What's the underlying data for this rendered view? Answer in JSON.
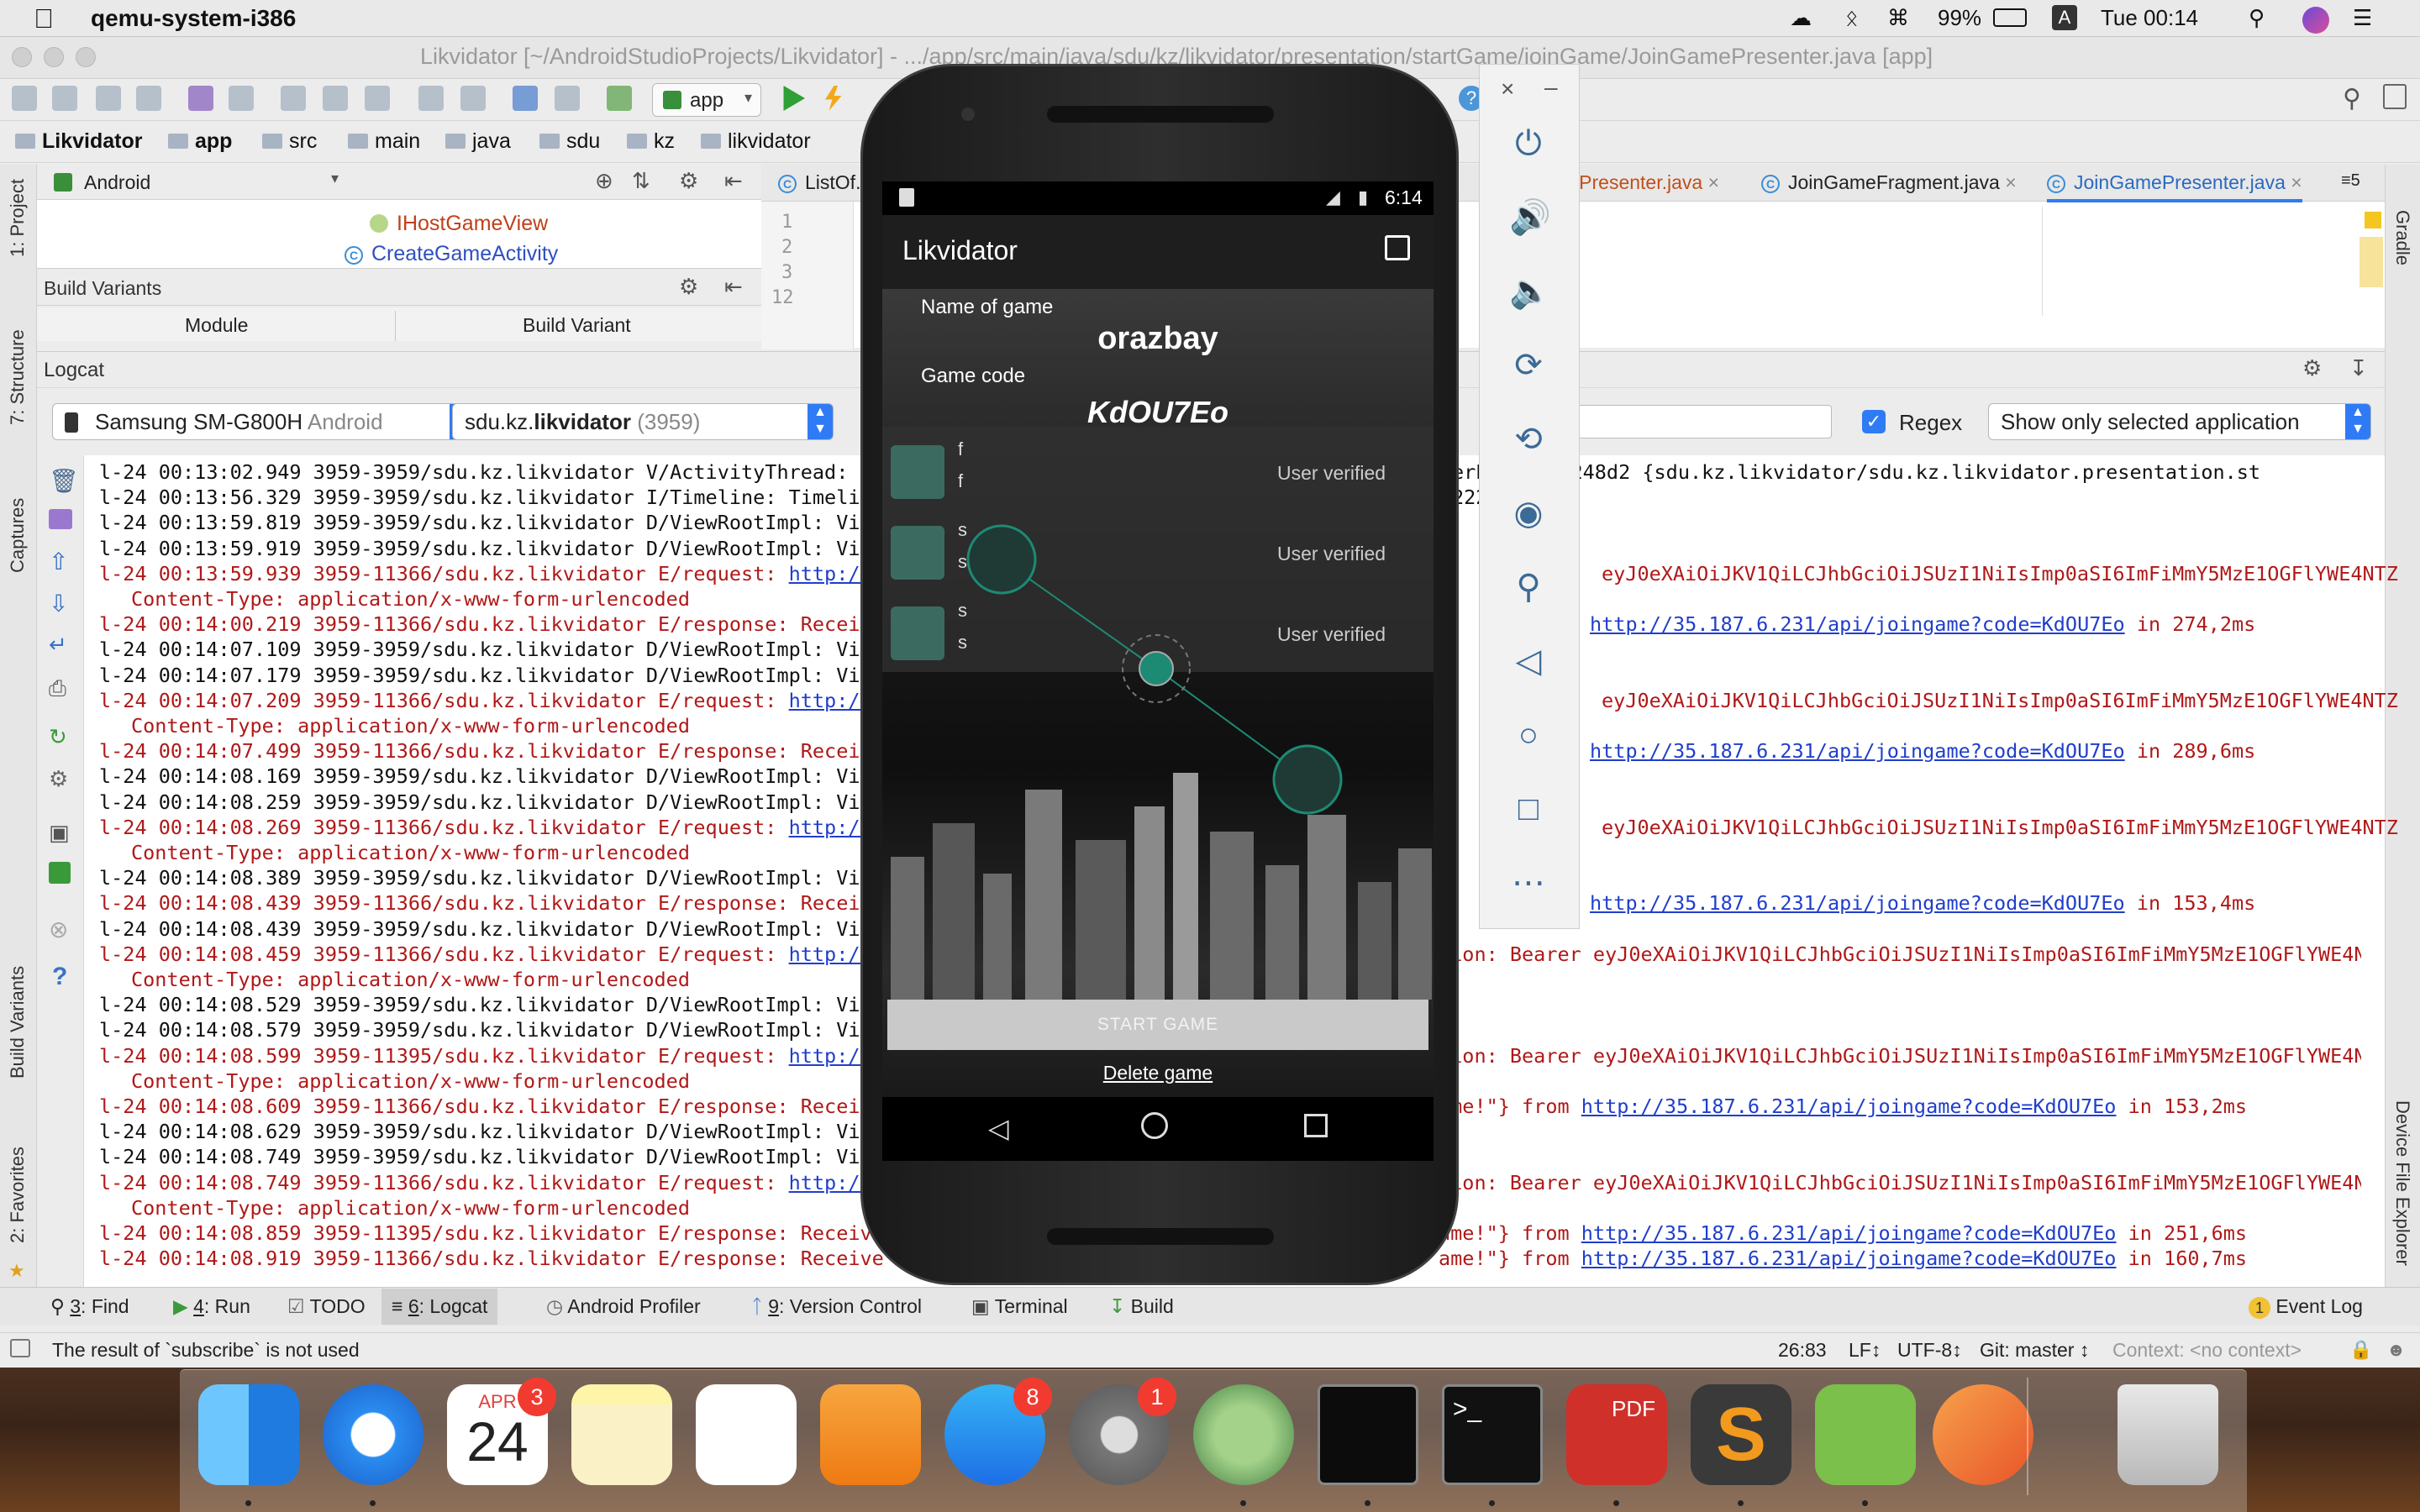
{
  "menubar": {
    "app_name": "qemu-system-i386",
    "battery": "99%",
    "input_source": "A",
    "clock": "Tue 00:14"
  },
  "window": {
    "title": "Likvidator [~/AndroidStudioProjects/Likvidator] - .../app/src/main/java/sdu/kz/likvidator/presentation/startGame/joinGame/JoinGamePresenter.java [app]"
  },
  "toolbar": {
    "run_config": "app"
  },
  "breadcrumb": [
    "Likvidator",
    "app",
    "src",
    "main",
    "java",
    "sdu",
    "kz",
    "likvidator"
  ],
  "project_panel": {
    "view_mode": "Android",
    "items": [
      "IHostGameView",
      "CreateGameActivity"
    ]
  },
  "build_variants": {
    "title": "Build Variants",
    "columns": [
      "Module",
      "Build Variant"
    ]
  },
  "editor": {
    "tabs": [
      "ListOf...",
      "...Presenter.java",
      "JoinGameFragment.java",
      "JoinGamePresenter.java"
    ],
    "tab_overflow": "5",
    "line_numbers": [
      "1",
      "2",
      "3",
      "12"
    ]
  },
  "logcat": {
    "title": "Logcat",
    "device": "Samsung SM-G800H",
    "device_os": "Android",
    "process_prefix": "sdu.kz.",
    "process_bold": "likvidator",
    "process_pid": "(3959)",
    "regex_label": "Regex",
    "regex_checked": true,
    "filter": "Show only selected application",
    "lines": [
      {
        "type": "v",
        "text": "l-24 00:13:02.949 3959-3959/sdu.kz.likvidator V/ActivityThread: u",
        "right": "erProxy@9f248d2 {sdu.kz.likvidator/sdu.kz.likvidator.presentation.st"
      },
      {
        "type": "v",
        "text": "l-24 00:13:56.329 3959-3959/sdu.kz.likvidator I/Timeline: Timelin",
        "right": "2228"
      },
      {
        "type": "v",
        "text": "l-24 00:13:59.819 3959-3959/sdu.kz.likvidator D/ViewRootImpl: Vie",
        "right": ""
      },
      {
        "type": "v",
        "text": "l-24 00:13:59.919 3959-3959/sdu.kz.likvidator D/ViewRootImpl: Vie",
        "right": ""
      },
      {
        "type": "e",
        "text": "l-24 00:13:59.939 3959-11366/sdu.kz.likvidator E/request: ",
        "link": "http://",
        "right": "eyJ0eXAiOiJKV1QiLCJhbGciOiJSUzI1NiIsImp0aSI6ImFiMmY5MzE1OGFlYWE4NTZ"
      },
      {
        "type": "cont",
        "text": "Content-Type: application/x-www-form-urlencoded",
        "right": ""
      },
      {
        "type": "e",
        "text": "l-24 00:14:00.219 3959-11366/sdu.kz.likvidator E/response: Receiv",
        "rlink": "http://35.187.6.231/api/joingame?code=KdOU7Eo",
        "rtail": " in 274,2ms"
      },
      {
        "type": "v",
        "text": "l-24 00:14:07.109 3959-3959/sdu.kz.likvidator D/ViewRootImpl: Vie",
        "right": ""
      },
      {
        "type": "v",
        "text": "l-24 00:14:07.179 3959-3959/sdu.kz.likvidator D/ViewRootImpl: Vie",
        "right": ""
      },
      {
        "type": "e",
        "text": "l-24 00:14:07.209 3959-11366/sdu.kz.likvidator E/request: ",
        "link": "http://",
        "right": "eyJ0eXAiOiJKV1QiLCJhbGciOiJSUzI1NiIsImp0aSI6ImFiMmY5MzE1OGFlYWE4NTZ"
      },
      {
        "type": "cont",
        "text": "Content-Type: application/x-www-form-urlencoded",
        "right": ""
      },
      {
        "type": "e",
        "text": "l-24 00:14:07.499 3959-11366/sdu.kz.likvidator E/response: Receiv",
        "rlink": "http://35.187.6.231/api/joingame?code=KdOU7Eo",
        "rtail": " in 289,6ms"
      },
      {
        "type": "v",
        "text": "l-24 00:14:08.169 3959-3959/sdu.kz.likvidator D/ViewRootImpl: Vie",
        "right": ""
      },
      {
        "type": "v",
        "text": "l-24 00:14:08.259 3959-3959/sdu.kz.likvidator D/ViewRootImpl: Vie",
        "right": ""
      },
      {
        "type": "e",
        "text": "l-24 00:14:08.269 3959-11366/sdu.kz.likvidator E/request: ",
        "link": "http://",
        "right": "eyJ0eXAiOiJKV1QiLCJhbGciOiJSUzI1NiIsImp0aSI6ImFiMmY5MzE1OGFlYWE4NTZ"
      },
      {
        "type": "cont",
        "text": "Content-Type: application/x-www-form-urlencoded",
        "right": ""
      },
      {
        "type": "v",
        "text": "l-24 00:14:08.389 3959-3959/sdu.kz.likvidator D/ViewRootImpl: Vie",
        "right": ""
      },
      {
        "type": "e",
        "text": "l-24 00:14:08.439 3959-11366/sdu.kz.likvidator E/response: Receiv",
        "rlink": "http://35.187.6.231/api/joingame?code=KdOU7Eo",
        "rtail": " in 153,4ms"
      },
      {
        "type": "v",
        "text": "l-24 00:14:08.439 3959-3959/sdu.kz.likvidator D/ViewRootImpl: Vie",
        "right": ""
      },
      {
        "type": "e",
        "text": "l-24 00:14:08.459 3959-11366/sdu.kz.likvidator E/request: ",
        "link": "http://",
        "right": "tion: Bearer eyJ0eXAiOiJKV1QiLCJhbGciOiJSUzI1NiIsImp0aSI6ImFiMmY5MzE1OGFlYWE4NTZ"
      },
      {
        "type": "cont",
        "text": "Content-Type: application/x-www-form-urlencoded",
        "right": ""
      },
      {
        "type": "v",
        "text": "l-24 00:14:08.529 3959-3959/sdu.kz.likvidator D/ViewRootImpl: Vie",
        "right": ""
      },
      {
        "type": "v",
        "text": "l-24 00:14:08.579 3959-3959/sdu.kz.likvidator D/ViewRootImpl: Vie",
        "right": ""
      },
      {
        "type": "e",
        "text": "l-24 00:14:08.599 3959-11395/sdu.kz.likvidator E/request: ",
        "link": "http://",
        "right": "tion: Bearer eyJ0eXAiOiJKV1QiLCJhbGciOiJSUzI1NiIsImp0aSI6ImFiMmY5MzE1OGFlYWE4NTZ"
      },
      {
        "type": "cont",
        "text": "Content-Type: application/x-www-form-urlencoded",
        "right": ""
      },
      {
        "type": "e",
        "text": "l-24 00:14:08.609 3959-11366/sdu.kz.likvidator E/response: Receiv",
        "rpre": "ame!\"} from ",
        "rlink": "http://35.187.6.231/api/joingame?code=KdOU7Eo",
        "rtail": " in 153,2ms"
      },
      {
        "type": "v",
        "text": "l-24 00:14:08.629 3959-3959/sdu.kz.likvidator D/ViewRootImpl: Vie",
        "right": ""
      },
      {
        "type": "v",
        "text": "l-24 00:14:08.749 3959-3959/sdu.kz.likvidator D/ViewRootImpl: Vie",
        "right": ""
      },
      {
        "type": "e",
        "text": "l-24 00:14:08.749 3959-11366/sdu.kz.likvidator E/request: ",
        "link": "http://",
        "right": "tion: Bearer eyJ0eXAiOiJKV1QiLCJhbGciOiJSUzI1NiIsImp0aSI6ImFiMmY5MzE1OGFlYWE4NTZ"
      },
      {
        "type": "cont",
        "text": "Content-Type: application/x-www-form-urlencoded",
        "right": ""
      },
      {
        "type": "e",
        "text": "l-24 00:14:08.859 3959-11395/sdu.kz.likvidator E/response: Receiv",
        "rpre": "ame!\"} from ",
        "rlink": "http://35.187.6.231/api/joingame?code=KdOU7Eo",
        "rtail": " in 251,6ms"
      },
      {
        "type": "e",
        "text": "l-24 00:14:08.919 3959-11366/sdu.kz.likvidator E/response: Receive",
        "rpre": "ame!\"} from ",
        "rlink": "http://35.187.6.231/api/joingame?code=KdOU7Eo",
        "rtail": " in 160,7ms"
      }
    ]
  },
  "tool_windows": [
    {
      "num": "3",
      "label": "Find"
    },
    {
      "num": "4",
      "label": "Run"
    },
    {
      "num": "",
      "label": "TODO"
    },
    {
      "num": "6",
      "label": "Logcat"
    },
    {
      "num": "",
      "label": "Android Profiler"
    },
    {
      "num": "9",
      "label": "Version Control"
    },
    {
      "num": "",
      "label": "Terminal"
    },
    {
      "num": "",
      "label": "Build"
    }
  ],
  "event_log": {
    "count": "1",
    "label": "Event Log"
  },
  "left_stripe": [
    "1: Project",
    "7: Structure",
    "Captures",
    "Build Variants",
    "2: Favorites"
  ],
  "right_stripe": [
    "Gradle",
    "Device File Explorer"
  ],
  "status": {
    "message": "The result of `subscribe` is not used",
    "position": "26:83",
    "line_sep": "LF↕",
    "encoding": "UTF-8↕",
    "git": "Git: master ↕",
    "context": "Context: <no context>"
  },
  "phone": {
    "status_time": "6:14",
    "app_title": "Likvidator",
    "name_label": "Name of game",
    "game_name": "orazbay",
    "code_label": "Game code",
    "game_code": "KdOU7Eo",
    "players": [
      {
        "line1": "f",
        "line2": "f",
        "status": "User verified"
      },
      {
        "line1": "s",
        "line2": "s",
        "status": "User verified"
      },
      {
        "line1": "s",
        "line2": "s",
        "status": "User verified"
      }
    ],
    "start_button": "START GAME",
    "delete_link": "Delete game"
  },
  "dock": {
    "calendar_month": "APR",
    "calendar_day": "24",
    "calendar_badge": "3",
    "appstore_badge": "8",
    "prefs_badge": "1",
    "pdf_label": "PDF"
  },
  "colors": {
    "accent": "#2f7bf5",
    "error_text": "#b01818",
    "link": "#1f3ecb",
    "joystick_teal": "#1d8a74"
  }
}
